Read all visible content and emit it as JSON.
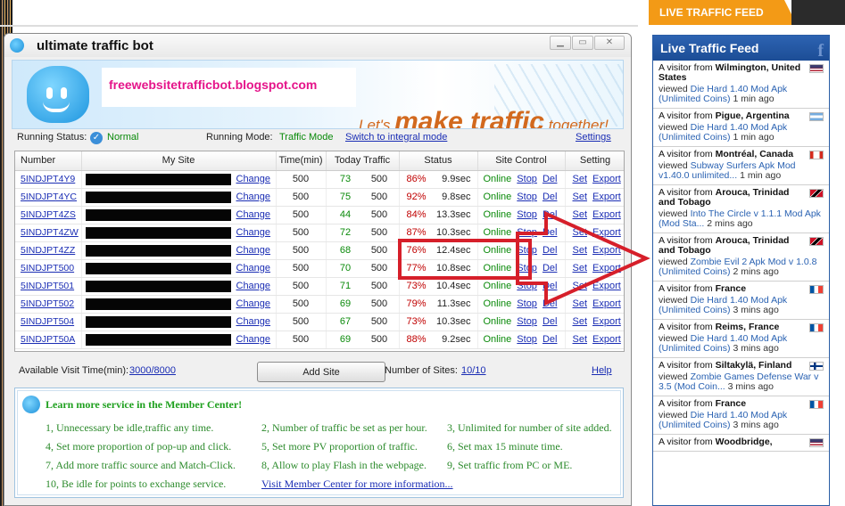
{
  "window": {
    "title": "ultimate traffic bot",
    "banner_blog": "freewebsitetrafficbot.blogspot.com",
    "slogan_pre": "Let's ",
    "slogan_big": "make traffic",
    "slogan_post": " together!"
  },
  "status": {
    "running_status_label": "Running Status:",
    "running_status_value": "Normal",
    "running_mode_label": "Running Mode:",
    "running_mode_value": "Traffic Mode",
    "switch_link": "Switch to integral mode",
    "settings_link": "Settings"
  },
  "table": {
    "headers": [
      "Number",
      "My Site",
      "Time(min)",
      "Today Traffic",
      "Status",
      "Site Control",
      "Setting"
    ],
    "change_label": "Change",
    "online_label": "Online",
    "stop_label": "Stop",
    "del_label": "Del",
    "set_label": "Set",
    "export_label": "Export",
    "rows": [
      {
        "number": "5INDJPT4Y9",
        "time": "500",
        "done": "73",
        "total": "500",
        "pct": "86%",
        "sec": "9.9sec"
      },
      {
        "number": "5INDJPT4YC",
        "time": "500",
        "done": "75",
        "total": "500",
        "pct": "92%",
        "sec": "9.8sec"
      },
      {
        "number": "5INDJPT4ZS",
        "time": "500",
        "done": "44",
        "total": "500",
        "pct": "84%",
        "sec": "13.3sec"
      },
      {
        "number": "5INDJPT4ZW",
        "time": "500",
        "done": "72",
        "total": "500",
        "pct": "87%",
        "sec": "10.3sec"
      },
      {
        "number": "5INDJPT4ZZ",
        "time": "500",
        "done": "68",
        "total": "500",
        "pct": "76%",
        "sec": "12.4sec"
      },
      {
        "number": "5INDJPT500",
        "time": "500",
        "done": "70",
        "total": "500",
        "pct": "77%",
        "sec": "10.8sec"
      },
      {
        "number": "5INDJPT501",
        "time": "500",
        "done": "71",
        "total": "500",
        "pct": "73%",
        "sec": "10.4sec"
      },
      {
        "number": "5INDJPT502",
        "time": "500",
        "done": "69",
        "total": "500",
        "pct": "79%",
        "sec": "11.3sec"
      },
      {
        "number": "5INDJPT504",
        "time": "500",
        "done": "67",
        "total": "500",
        "pct": "73%",
        "sec": "10.3sec"
      },
      {
        "number": "5INDJPT50A",
        "time": "500",
        "done": "69",
        "total": "500",
        "pct": "88%",
        "sec": "9.2sec"
      }
    ]
  },
  "bottom": {
    "visit_time_label": "Available Visit Time(min):",
    "visit_time_value": "3000/8000",
    "add_site": "Add Site",
    "num_sites_label": "Number of Sites:",
    "num_sites_value": "10/10",
    "help": "Help"
  },
  "member": {
    "title": "Learn more service in the Member Center!",
    "items": [
      "1, Unnecessary be idle,traffic any time.",
      "2, Number of traffic be set as per hour.",
      "3, Unlimited for number of site added.",
      "4, Set more proportion of pop-up and click.",
      "5, Set more PV proportion of traffic.",
      "6, Set max 15 minute time.",
      "7, Add more traffic source and Match-Click.",
      "8, Allow to play Flash in the webpage.",
      "9, Set traffic from PC or ME.",
      "10, Be idle for points to exchange service."
    ],
    "link": "Visit Member Center for more information..."
  },
  "feed": {
    "tab_label": "LIVE TRAFFIC FEED",
    "header": "Live Traffic Feed",
    "fb": "f",
    "visitor_prefix": "A visitor from",
    "viewed_prefix": "viewed",
    "items": [
      {
        "loc": "Wilmington, United States",
        "title": "Die Hard 1.40 Mod Apk (Unlimited Coins)",
        "ago": "1 min ago",
        "flag": "flag-us"
      },
      {
        "loc": "Pigue, Argentina",
        "title": "Die Hard 1.40 Mod Apk (Unlimited Coins)",
        "ago": "1 min ago",
        "flag": "flag-ar"
      },
      {
        "loc": "Montréal, Canada",
        "title": "Subway Surfers Apk Mod v1.40.0 unlimited...",
        "ago": "1 min ago",
        "flag": "flag-ca"
      },
      {
        "loc": "Arouca, Trinidad and Tobago",
        "title": "Into The Circle v 1.1.1 Mod Apk (Mod Sta...",
        "ago": "2 mins ago",
        "flag": "flag-tt"
      },
      {
        "loc": "Arouca, Trinidad and Tobago",
        "title": "Zombie Evil 2 Apk Mod v 1.0.8 (Unlimited Coins)",
        "ago": "2 mins ago",
        "flag": "flag-tt"
      },
      {
        "loc": "France",
        "title": "Die Hard 1.40 Mod Apk (Unlimited Coins)",
        "ago": "3 mins ago",
        "flag": "flag-fr"
      },
      {
        "loc": "Reims, France",
        "title": "Die Hard 1.40 Mod Apk (Unlimited Coins)",
        "ago": "3 mins ago",
        "flag": "flag-fr"
      },
      {
        "loc": "Siltakylä, Finland",
        "title": "Zombie Games Defense War v 3.5 (Mod Coin...",
        "ago": "3 mins ago",
        "flag": "flag-fi"
      },
      {
        "loc": "France",
        "title": "Die Hard 1.40 Mod Apk (Unlimited Coins)",
        "ago": "3 mins ago",
        "flag": "flag-fr"
      },
      {
        "loc": "Woodbridge,",
        "title": "",
        "ago": "",
        "flag": "flag-us"
      }
    ]
  }
}
